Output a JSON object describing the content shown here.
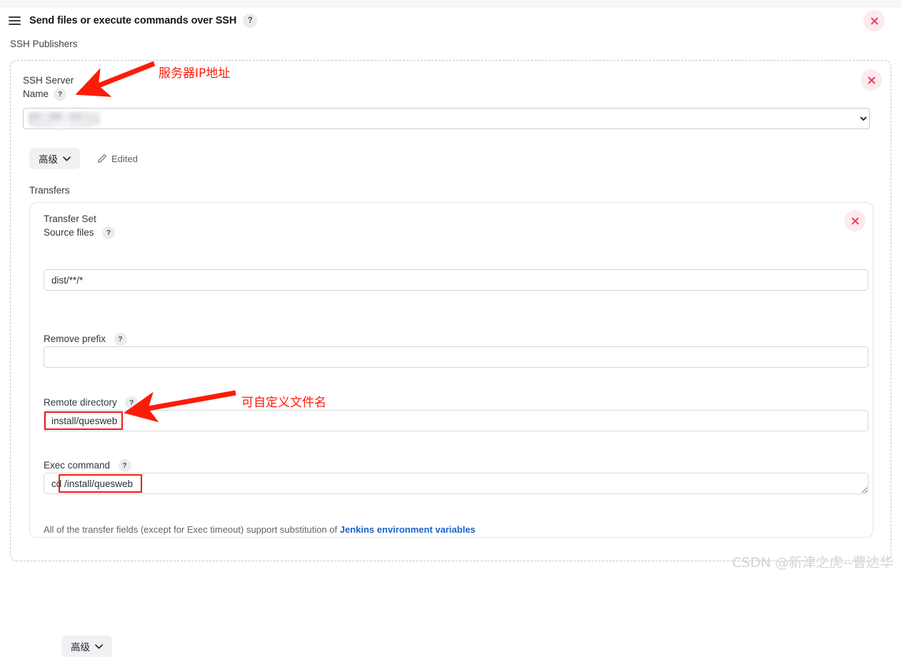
{
  "window": {
    "title": "Send files or execute commands over SSH",
    "help_badge": "?",
    "drag_handle_icon": "hamburger-drag-icon",
    "close_icon": "close-icon"
  },
  "section": {
    "label": "SSH Publishers"
  },
  "ssh_server": {
    "label_line1": "SSH Server",
    "label_line2": "Name",
    "help_badge": "?",
    "selected_value": "",
    "value_redacted": true,
    "options": [
      ""
    ],
    "close_icon": "close-icon"
  },
  "advanced_top": {
    "label": "高级",
    "chevron_icon": "chevron-down-icon"
  },
  "edited": {
    "label": "Edited",
    "icon": "pencil-icon"
  },
  "transfers": {
    "label": "Transfers"
  },
  "transfer_set": {
    "title": "Transfer Set",
    "close_icon": "close-icon",
    "fields": [
      {
        "name": "source-files",
        "label": "Source files",
        "help_badge": "?",
        "value": "dist/**/*",
        "placeholder": ""
      },
      {
        "name": "remove-prefix",
        "label": "Remove prefix",
        "help_badge": "?",
        "value": "",
        "placeholder": ""
      },
      {
        "name": "remote-directory",
        "label": "Remote directory",
        "help_badge": "?",
        "value": "install/quesweb",
        "placeholder": ""
      },
      {
        "name": "exec-command",
        "label": "Exec command",
        "help_badge": "?",
        "value": "cd /install/quesweb",
        "placeholder": ""
      }
    ],
    "footnote_prefix": "All of the transfer fields (except for Exec timeout) support substitution of ",
    "footnote_link": "Jenkins environment variables",
    "advanced_label": "高级",
    "advanced_chevron_icon": "chevron-down-icon"
  },
  "annotations": [
    {
      "text": "服务器IP地址",
      "color": "#fd1b08",
      "arrow": "arrow-down-left"
    },
    {
      "text": "可自定义文件名",
      "color": "#fd1b08",
      "arrow": "arrow-left"
    }
  ],
  "watermark": "CSDN @新津之虎--曹达华",
  "colors": {
    "accent_link": "#1b63c9",
    "annotation_red": "#fd1b08",
    "close_bg": "#fdeaee",
    "close_fg": "#e8415f",
    "panel_dashed_border": "#b9c6c9"
  }
}
